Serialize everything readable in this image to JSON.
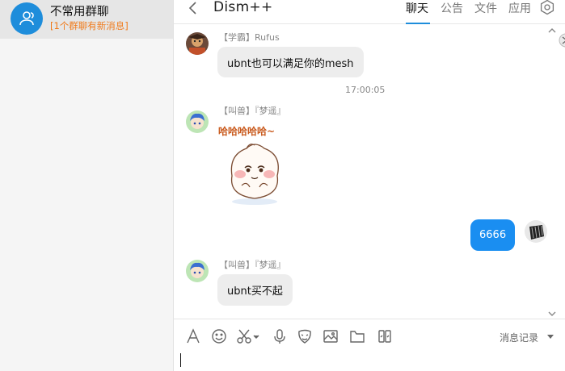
{
  "sidebar": {
    "conversation": {
      "title": "不常用群聊",
      "subtitle": "[1个群聊有新消息]",
      "icon": "group-icon"
    }
  },
  "header": {
    "title": "Dism++",
    "tabs": [
      {
        "label": "聊天",
        "active": true
      },
      {
        "label": "公告",
        "active": false
      },
      {
        "label": "文件",
        "active": false
      },
      {
        "label": "应用",
        "active": false
      }
    ],
    "accent_color": "#1e8ddb"
  },
  "messages": [
    {
      "sender": "【学霸】Rufus",
      "text": "ubnt也可以满足你的mesh",
      "direction": "in"
    },
    {
      "time": "17:00:05"
    },
    {
      "sender": "【叫兽】『梦遥』",
      "sticker_text": "哈哈哈哈哈~",
      "direction": "in"
    },
    {
      "text": "6666",
      "direction": "out"
    },
    {
      "sender": "【叫兽】『梦遥』",
      "text": "ubnt买不起",
      "direction": "in"
    }
  ],
  "toolbar": {
    "icons": [
      "font-icon",
      "emoji-icon",
      "scissors-icon",
      "microphone-icon",
      "face-icon",
      "image-icon",
      "folder-icon",
      "gallery-icon"
    ],
    "history_label": "消息记录"
  },
  "colors": {
    "out_bubble": "#1a8ef1",
    "in_bubble": "#ededed",
    "highlight_orange": "#f07a1a"
  }
}
